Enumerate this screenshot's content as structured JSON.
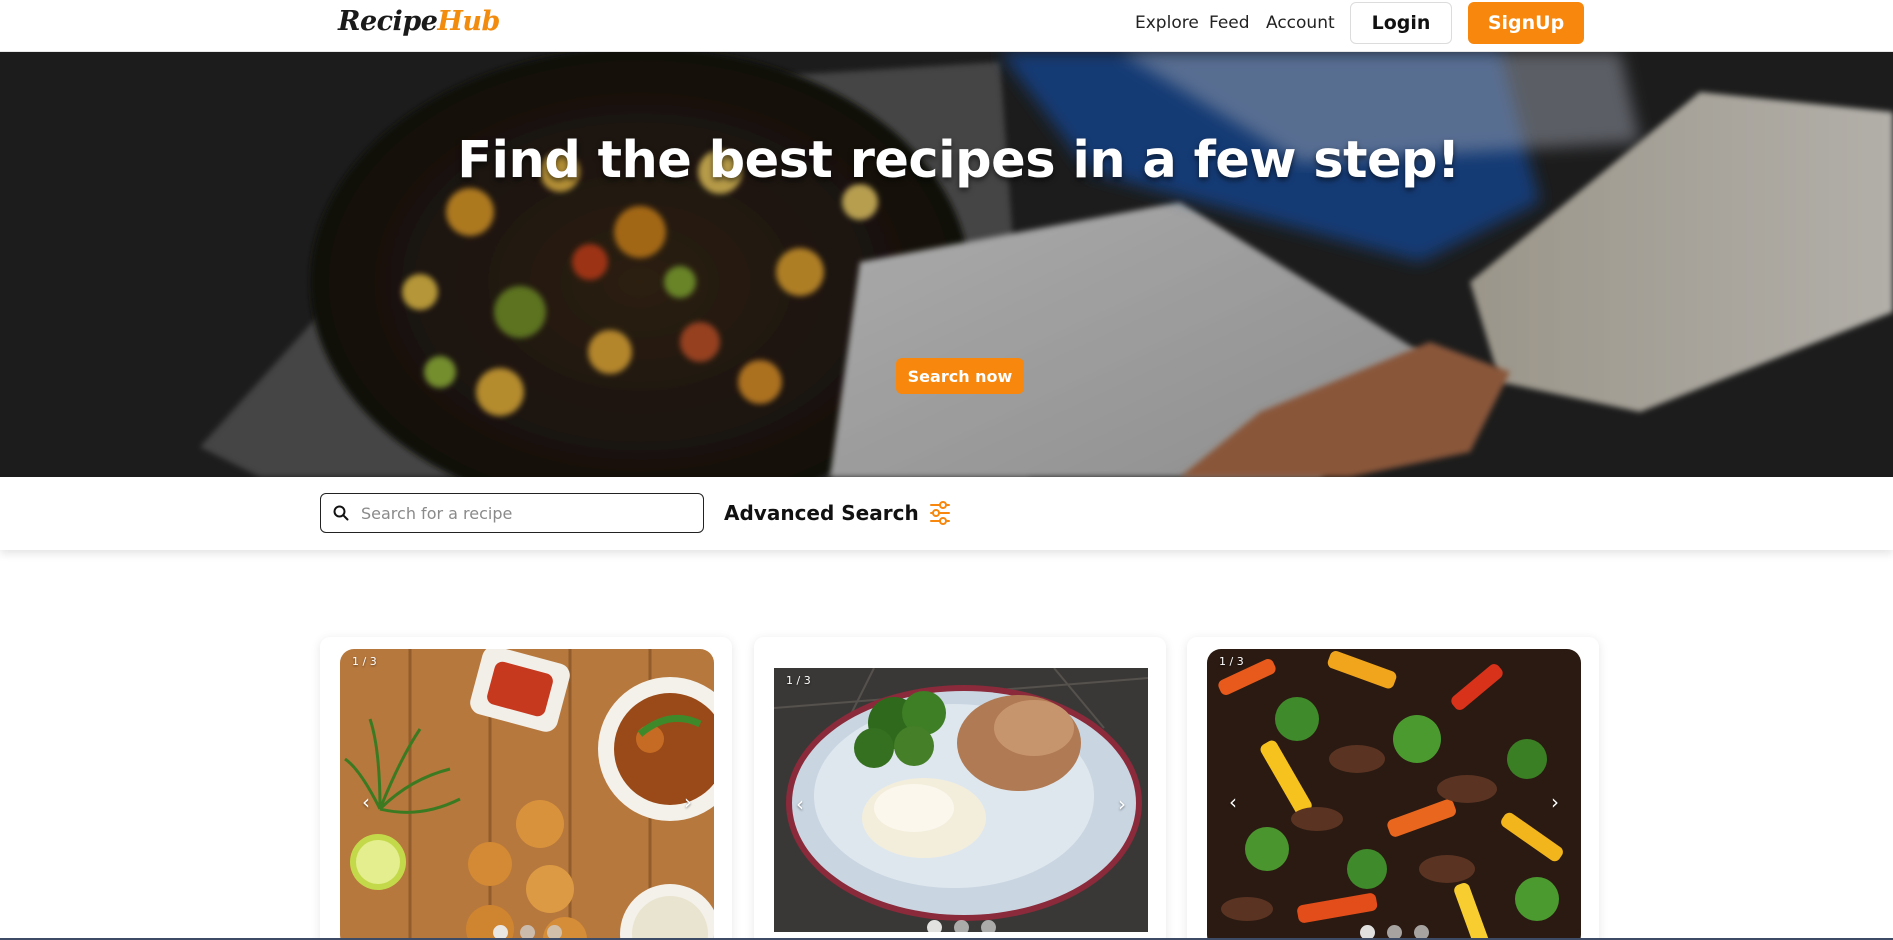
{
  "brand": {
    "logo_part1": "Recipe",
    "logo_part2": "Hub",
    "accent": "#f7870d"
  },
  "nav": {
    "links": [
      "Explore",
      "Feed",
      "Account"
    ],
    "login_label": "Login",
    "signup_label": "SignUp"
  },
  "hero": {
    "title": "Find the best recipes in a few step!",
    "cta_label": "Search now"
  },
  "search": {
    "placeholder": "Search for a recipe",
    "advanced_label": "Advanced Search",
    "search_icon": "search-icon",
    "filter_icon": "sliders-icon"
  },
  "cards": [
    {
      "counter": "1 / 3",
      "slides": 3,
      "active_slide": 1
    },
    {
      "counter": "1 / 3",
      "slides": 3,
      "active_slide": 1
    },
    {
      "counter": "1 / 3",
      "slides": 3,
      "active_slide": 1
    }
  ]
}
